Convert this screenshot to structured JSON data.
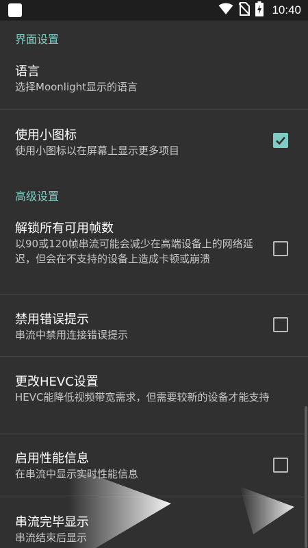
{
  "status_bar": {
    "time": "10:40",
    "icons": [
      "app-icon",
      "wifi-icon",
      "no-sim-icon",
      "battery-charging-icon"
    ]
  },
  "colors": {
    "accent": "#80cbc4",
    "background": "#303030",
    "status_bar": "#1e1e1e"
  },
  "sections": [
    {
      "category": "界面设置"
    },
    {
      "category": "高级设置"
    }
  ],
  "prefs": [
    {
      "title": "语言",
      "summary": "选择Moonlight显示的语言",
      "checkbox": null
    },
    {
      "title": "使用小图标",
      "summary": "使用小图标以在屏幕上显示更多项目",
      "checkbox": true
    },
    {
      "title": "解锁所有可用帧数",
      "summary": "以90或120帧串流可能会减少在高端设备上的网络延迟，但会在不支持的设备上造成卡顿或崩溃",
      "checkbox": false
    },
    {
      "title": "禁用错误提示",
      "summary": "串流中禁用连接错误提示",
      "checkbox": false
    },
    {
      "title": "更改HEVC设置",
      "summary": "HEVC能降低视频带宽需求，但需要较新的设备才能支持",
      "checkbox": null
    },
    {
      "title": "启用性能信息",
      "summary": "在串流中显示实时性能信息",
      "checkbox": false
    },
    {
      "title": "串流完毕显示",
      "summary": "串流结束后显示",
      "checkbox": null
    }
  ]
}
